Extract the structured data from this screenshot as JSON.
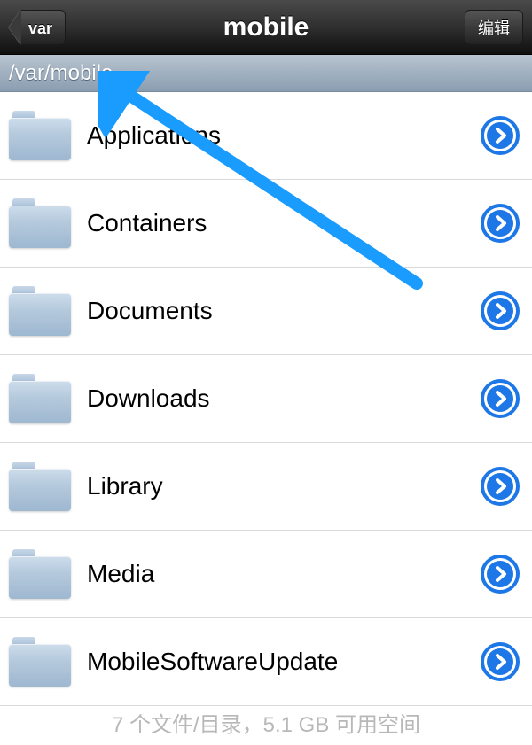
{
  "navbar": {
    "back_label": "var",
    "title": "mobile",
    "edit_label": "编辑"
  },
  "path": "/var/mobile",
  "folders": [
    {
      "name": "Applications"
    },
    {
      "name": "Containers"
    },
    {
      "name": "Documents"
    },
    {
      "name": "Downloads"
    },
    {
      "name": "Library"
    },
    {
      "name": "Media"
    },
    {
      "name": "MobileSoftwareUpdate"
    }
  ],
  "footer": "7 个文件/目录，5.1 GB 可用空间",
  "colors": {
    "accent": "#1d77e6",
    "folder": "#a8c0d8",
    "annotation_arrow": "#1a9cff"
  }
}
